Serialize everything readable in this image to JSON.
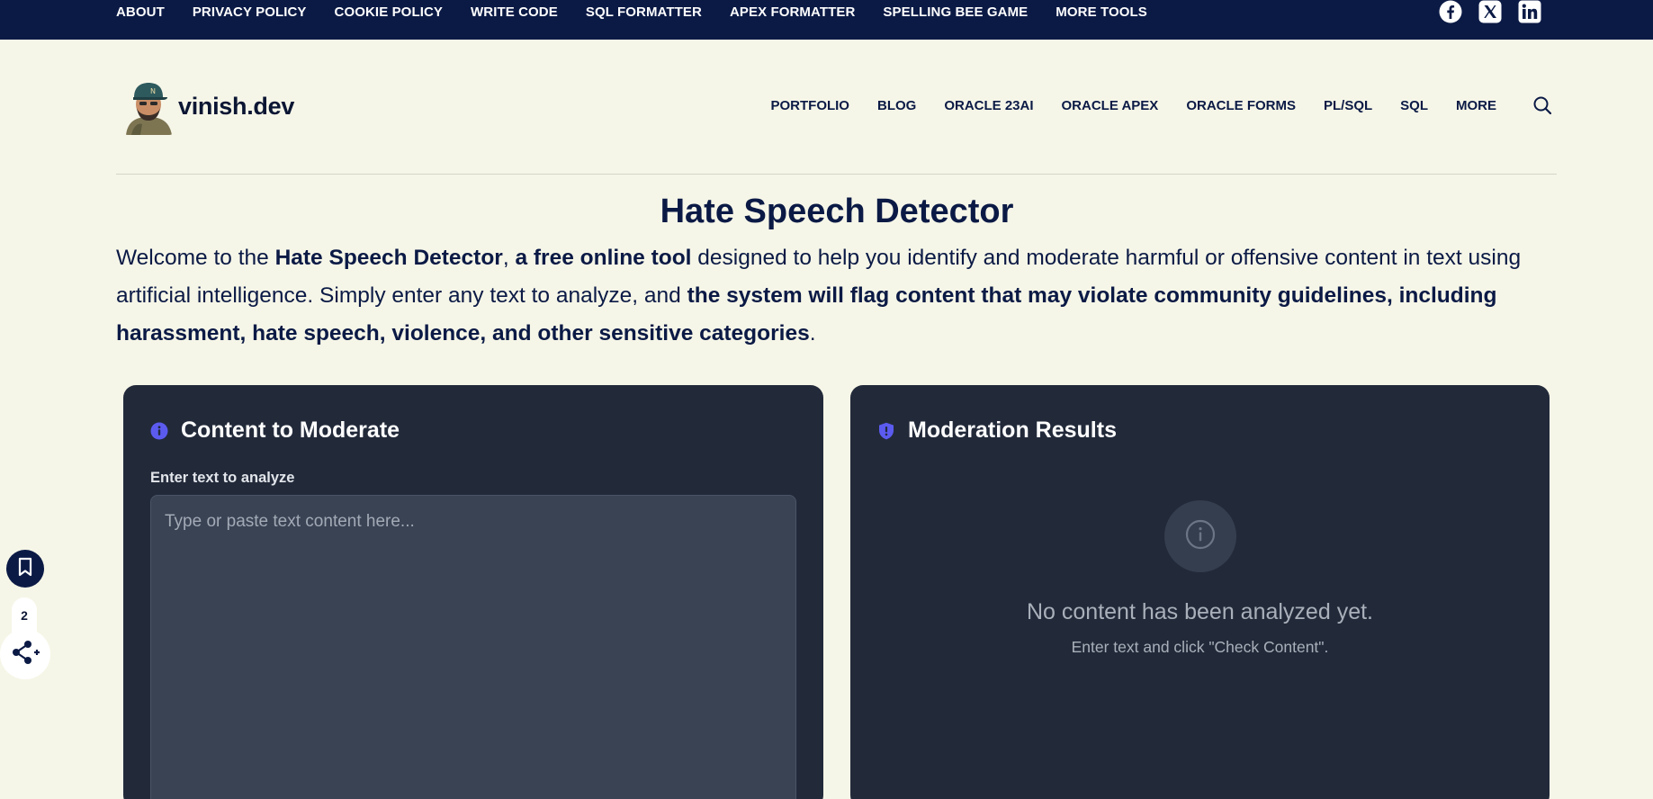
{
  "topnav": {
    "items": [
      "ABOUT",
      "PRIVACY POLICY",
      "COOKIE POLICY",
      "WRITE CODE",
      "SQL FORMATTER",
      "APEX FORMATTER",
      "SPELLING BEE GAME",
      "MORE TOOLS"
    ],
    "social_icons": [
      "facebook-icon",
      "x-icon",
      "linkedin-icon"
    ]
  },
  "header": {
    "brand": "vinish.dev",
    "nav": [
      "PORTFOLIO",
      "BLOG",
      "ORACLE 23AI",
      "ORACLE APEX",
      "ORACLE FORMS",
      "PL/SQL",
      "SQL",
      "MORE"
    ]
  },
  "page": {
    "title": "Hate Speech Detector",
    "intro": {
      "p1": "Welcome to the ",
      "b1": "Hate Speech Detector",
      "p2": ", ",
      "b2": "a free online tool",
      "p3": " designed to help you identify and moderate harmful or offensive content in text using artificial intelligence. Simply enter any text to analyze, and ",
      "b3": "the system will flag content that may violate community guidelines, including harassment, hate speech, violence, and other sensitive categories",
      "p4": "."
    }
  },
  "left_panel": {
    "title": "Content to Moderate",
    "field_label": "Enter text to analyze",
    "placeholder": "Type or paste text content here...",
    "value": ""
  },
  "right_panel": {
    "title": "Moderation Results",
    "empty_title": "No content has been analyzed yet.",
    "empty_subtitle": "Enter text and click \"Check Content\"."
  },
  "floating": {
    "share_count": "2"
  },
  "colors": {
    "topbar": "#0b1a45",
    "page_bg": "#f6f6e8",
    "panel_bg": "#222a3a",
    "accent": "#5b5bf0"
  }
}
